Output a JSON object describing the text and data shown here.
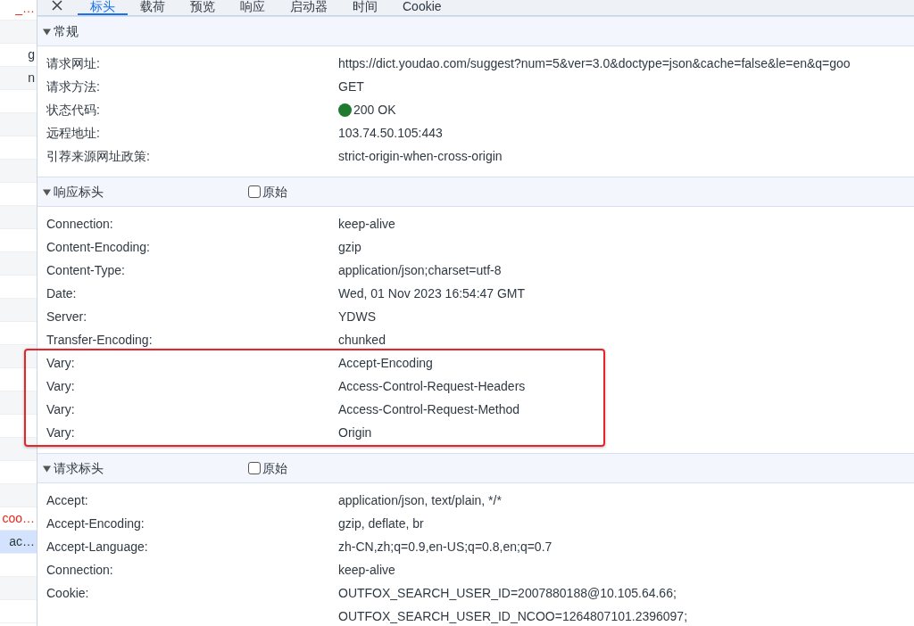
{
  "sidebar": {
    "items": [
      {
        "text": "_…",
        "kind": "error",
        "selected": false
      },
      {
        "selected": false
      },
      {
        "text": "g",
        "kind": "normal",
        "selected": false
      },
      {
        "text": "n",
        "kind": "normal",
        "selected": false
      },
      {
        "selected": false
      },
      {
        "selected": false
      },
      {
        "selected": false
      },
      {
        "selected": false
      },
      {
        "selected": false
      },
      {
        "selected": false
      },
      {
        "selected": false
      },
      {
        "selected": false
      },
      {
        "selected": false
      },
      {
        "selected": false
      },
      {
        "selected": false
      },
      {
        "selected": false
      },
      {
        "selected": false
      },
      {
        "selected": false
      },
      {
        "selected": false
      },
      {
        "selected": false
      },
      {
        "selected": false
      },
      {
        "selected": false
      },
      {
        "text": "coo…",
        "kind": "error",
        "selected": false
      },
      {
        "text": "ac…",
        "kind": "normal",
        "selected": true
      },
      {
        "selected": false
      },
      {
        "selected": false
      },
      {
        "selected": false
      }
    ]
  },
  "tabs": [
    {
      "label": "标头",
      "selected": true
    },
    {
      "label": "载荷",
      "selected": false
    },
    {
      "label": "预览",
      "selected": false
    },
    {
      "label": "响应",
      "selected": false
    },
    {
      "label": "启动器",
      "selected": false
    },
    {
      "label": "时间",
      "selected": false
    },
    {
      "label": "Cookie",
      "selected": false
    }
  ],
  "sections": [
    {
      "title": "常规",
      "expanded": true,
      "rows": [
        {
          "name": "请求网址:",
          "value": "https://dict.youdao.com/suggest?num=5&ver=3.0&doctype=json&cache=false&le=en&q=goo"
        },
        {
          "name": "请求方法:",
          "value": "GET"
        },
        {
          "name": "状态代码:",
          "value": "200 OK",
          "color": "#1e7a2f"
        },
        {
          "name": "远程地址:",
          "value": "103.74.50.105:443"
        },
        {
          "name": "引荐来源网址政策:",
          "value": "strict-origin-when-cross-origin"
        }
      ]
    },
    {
      "title": "响应标头",
      "expanded": true,
      "raw": {
        "label": "原始",
        "checked": false
      },
      "rows": [
        {
          "name": "Connection:",
          "value": "keep-alive"
        },
        {
          "name": "Content-Encoding:",
          "value": "gzip"
        },
        {
          "name": "Content-Type:",
          "value": "application/json;charset=utf-8"
        },
        {
          "name": "Date:",
          "value": "Wed, 01 Nov 2023 16:54:47 GMT"
        },
        {
          "name": "Server:",
          "value": "YDWS"
        },
        {
          "name": "Transfer-Encoding:",
          "value": "chunked"
        },
        {
          "name": "Vary:",
          "value": "Accept-Encoding",
          "highlighted": true
        },
        {
          "name": "Vary:",
          "value": "Access-Control-Request-Headers",
          "highlighted": true
        },
        {
          "name": "Vary:",
          "value": "Access-Control-Request-Method",
          "highlighted": true
        },
        {
          "name": "Vary:",
          "value": "Origin",
          "highlighted": true
        }
      ]
    },
    {
      "title": "请求标头",
      "expanded": true,
      "raw": {
        "label": "原始",
        "checked": false
      },
      "rows": [
        {
          "name": "Accept:",
          "value": "application/json, text/plain, */*"
        },
        {
          "name": "Accept-Encoding:",
          "value": "gzip, deflate, br"
        },
        {
          "name": "Accept-Language:",
          "value": "zh-CN,zh;q=0.9,en-US;q=0.8,en;q=0.7"
        },
        {
          "name": "Connection:",
          "value": "keep-alive"
        },
        {
          "name": "Cookie:",
          "value": "OUTFOX_SEARCH_USER_ID=2007880188@10.105.64.66;"
        },
        {
          "value": "OUTFOX_SEARCH_USER_ID_NCOO=1264807101.2396097;"
        }
      ]
    }
  ]
}
